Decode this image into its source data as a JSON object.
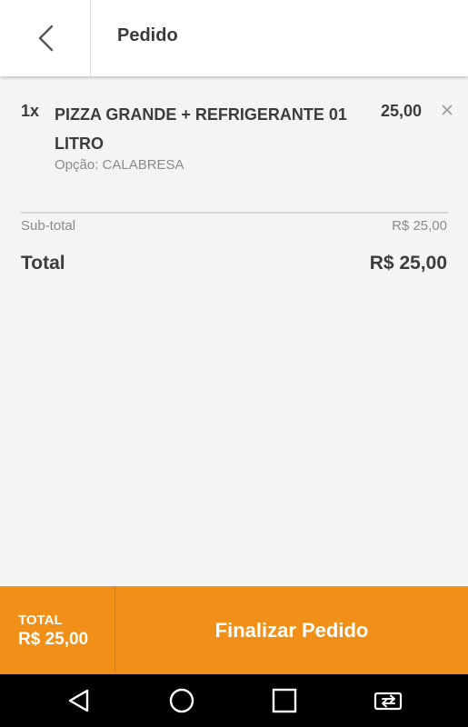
{
  "header": {
    "title": "Pedido",
    "back_icon": "chevron-left-icon"
  },
  "order": {
    "items": [
      {
        "qty": "1x",
        "name": "PIZZA GRANDE + REFRIGERANTE 01 LITRO",
        "price": "25,00",
        "option": "Opção: CALABRESA",
        "remove_icon": "close-icon"
      }
    ],
    "subtotal_label": "Sub-total",
    "subtotal_value": "R$ 25,00",
    "total_label": "Total",
    "total_value": "R$ 25,00"
  },
  "footer": {
    "total_label": "TOTAL",
    "total_value": "R$ 25,00",
    "finish_label": "Finalizar Pedido"
  },
  "navbar": {
    "icons": [
      "back-triangle-icon",
      "home-circle-icon",
      "recents-square-icon",
      "switch-app-icon"
    ]
  },
  "colors": {
    "accent": "#f09019",
    "background": "#f4f4f4",
    "text_dark": "#3c3c3c",
    "text_muted": "#8a8a8a"
  }
}
